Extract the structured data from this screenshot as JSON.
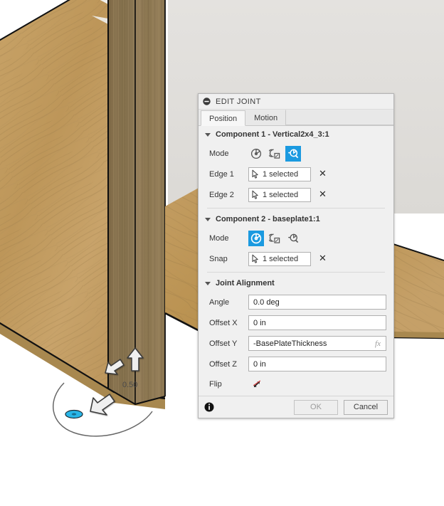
{
  "viewport": {
    "name": "fusion-3d-viewport",
    "background_color": "#ffffff",
    "dimension_label": "0.50",
    "components": [
      {
        "name": "vertical-2x4-post",
        "material": "wood",
        "color": "#8f7954"
      },
      {
        "name": "baseplate-panel-left",
        "material": "plywood",
        "color": "#c09a63"
      },
      {
        "name": "baseplate-panel-right",
        "material": "plywood",
        "color": "#c09a63"
      },
      {
        "name": "wall-panel",
        "material": "painted",
        "color": "#e0dedb"
      }
    ],
    "manipulators": [
      {
        "name": "joint-origin-marker",
        "color": "#29b6e8"
      },
      {
        "name": "rotate-arc-handle",
        "color": "#4a4a4a"
      },
      {
        "name": "translate-arrow-up",
        "color": "#efefef"
      },
      {
        "name": "translate-arrow-left",
        "color": "#efefef"
      },
      {
        "name": "translate-arrow-lower-left",
        "color": "#efefef"
      }
    ]
  },
  "dialog": {
    "title": "EDIT JOINT",
    "title_icon": "collapse-circle-icon",
    "tabs": [
      {
        "label": "Position",
        "active": true
      },
      {
        "label": "Motion",
        "active": false
      }
    ],
    "component1": {
      "header": "Component 1 - Vertical2x4_3:1",
      "mode_label": "Mode",
      "modes": [
        {
          "name": "simple-mode",
          "icon": "joint-simple-icon",
          "selected": false
        },
        {
          "name": "between-two-faces-mode",
          "icon": "joint-between-two-faces-icon",
          "selected": false
        },
        {
          "name": "two-edge-intersection-mode",
          "icon": "joint-two-edge-intersection-icon",
          "selected": true
        }
      ],
      "rows": [
        {
          "label": "Edge 1",
          "value": "1 selected"
        },
        {
          "label": "Edge 2",
          "value": "1 selected"
        }
      ]
    },
    "component2": {
      "header": "Component 2 - baseplate1:1",
      "mode_label": "Mode",
      "modes": [
        {
          "name": "simple-mode",
          "icon": "joint-simple-icon",
          "selected": true
        },
        {
          "name": "between-two-faces-mode",
          "icon": "joint-between-two-faces-icon",
          "selected": false
        },
        {
          "name": "two-edge-intersection-mode",
          "icon": "joint-two-edge-intersection-icon",
          "selected": false
        }
      ],
      "rows": [
        {
          "label": "Snap",
          "value": "1 selected"
        }
      ]
    },
    "joint_alignment": {
      "header": "Joint Alignment",
      "fields": [
        {
          "label": "Angle",
          "value": "0.0 deg",
          "fx": false
        },
        {
          "label": "Offset X",
          "value": "0 in",
          "fx": false
        },
        {
          "label": "Offset Y",
          "value": "-BasePlateThickness",
          "fx": true,
          "fx_label": "fx"
        },
        {
          "label": "Offset Z",
          "value": "0 in",
          "fx": false
        }
      ],
      "flip_label": "Flip",
      "flip_icon": "flip-disabled-icon"
    },
    "footer": {
      "info_icon": "info-icon",
      "ok_label": "OK",
      "ok_disabled": true,
      "cancel_label": "Cancel"
    },
    "accent_color": "#1b9ae0"
  }
}
